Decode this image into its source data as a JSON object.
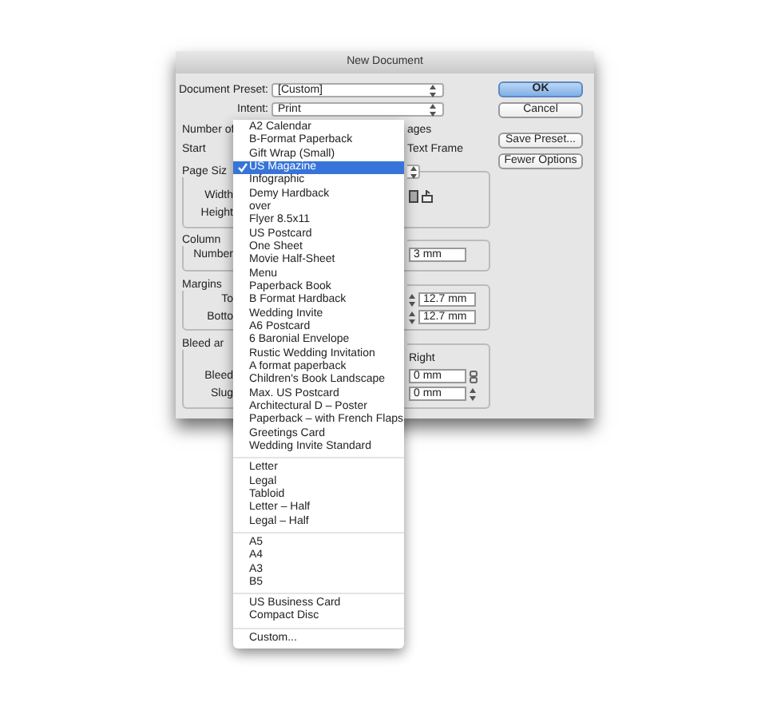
{
  "dialog": {
    "title": "New Document",
    "selects": [
      {
        "label": "Document Preset:",
        "value": "[Custom]"
      },
      {
        "label": "Intent:",
        "value": "Print"
      }
    ],
    "rows": [
      {
        "label": "Number of",
        "trailing": "ages"
      },
      {
        "label": "Start",
        "trailing": "Text Frame"
      }
    ],
    "groups": [
      {
        "label": "Page Siz",
        "kind": "select",
        "rows": [
          {
            "label": "Width",
            "kind": "orientation"
          },
          {
            "label": "Height",
            "kind": "plain"
          }
        ]
      },
      {
        "label": "Column",
        "kind": "box",
        "rows": [
          {
            "label": "Number",
            "kind": "field",
            "value": "3 mm"
          }
        ]
      },
      {
        "label": "Margins",
        "kind": "box",
        "rows": [
          {
            "label": "To",
            "kind": "spin",
            "value": "12.7 mm"
          },
          {
            "label": "Botto",
            "kind": "spin",
            "value": "12.7 mm"
          }
        ]
      },
      {
        "label": "Bleed ar",
        "kind": "box",
        "heading": "Right",
        "rows": [
          {
            "label": "Bleed",
            "kind": "chain",
            "value": "0 mm"
          },
          {
            "label": "Slug",
            "kind": "stepper",
            "value": "0 mm"
          }
        ]
      }
    ],
    "buttons": [
      {
        "label": "OK",
        "default": true
      },
      {
        "label": "Cancel",
        "default": false
      },
      {
        "label": "Save Preset...",
        "default": false
      },
      {
        "label": "Fewer Options",
        "default": false
      }
    ]
  },
  "menu": {
    "groups": [
      {
        "items": [
          {
            "label": "A2 Calendar",
            "selected": false
          },
          {
            "label": "B-Format Paperback",
            "selected": false
          },
          {
            "label": "Gift Wrap (Small)",
            "selected": false
          },
          {
            "label": "US Magazine",
            "selected": true
          },
          {
            "label": "Infographic",
            "selected": false
          },
          {
            "label": "Demy Hardback",
            "selected": false
          },
          {
            "label": "over",
            "selected": false
          },
          {
            "label": "Flyer 8.5x11",
            "selected": false
          },
          {
            "label": "US Postcard",
            "selected": false
          },
          {
            "label": "One Sheet",
            "selected": false
          },
          {
            "label": "Movie Half-Sheet",
            "selected": false
          },
          {
            "label": "Menu",
            "selected": false
          },
          {
            "label": "Paperback Book",
            "selected": false
          },
          {
            "label": "B Format Hardback",
            "selected": false
          },
          {
            "label": "Wedding Invite",
            "selected": false
          },
          {
            "label": "A6 Postcard",
            "selected": false
          },
          {
            "label": "6 Baronial Envelope",
            "selected": false
          },
          {
            "label": "Rustic Wedding Invitation",
            "selected": false
          },
          {
            "label": "A format paperback",
            "selected": false
          },
          {
            "label": "Children's Book Landscape",
            "selected": false
          },
          {
            "label": "Max. US Postcard",
            "selected": false
          },
          {
            "label": "Architectural D – Poster",
            "selected": false
          },
          {
            "label": "Paperback – with French Flaps",
            "selected": false
          },
          {
            "label": "Greetings Card",
            "selected": false
          },
          {
            "label": "Wedding Invite Standard",
            "selected": false
          }
        ]
      },
      {
        "items": [
          {
            "label": "Letter",
            "selected": false
          },
          {
            "label": "Legal",
            "selected": false
          },
          {
            "label": "Tabloid",
            "selected": false
          },
          {
            "label": "Letter – Half",
            "selected": false
          },
          {
            "label": "Legal – Half",
            "selected": false
          }
        ]
      },
      {
        "items": [
          {
            "label": "A5",
            "selected": false
          },
          {
            "label": "A4",
            "selected": false
          },
          {
            "label": "A3",
            "selected": false
          },
          {
            "label": "B5",
            "selected": false
          }
        ]
      },
      {
        "items": [
          {
            "label": "US Business Card",
            "selected": false
          },
          {
            "label": "Compact Disc",
            "selected": false
          }
        ]
      },
      {
        "items": [
          {
            "label": "Custom...",
            "selected": false
          }
        ]
      }
    ]
  }
}
